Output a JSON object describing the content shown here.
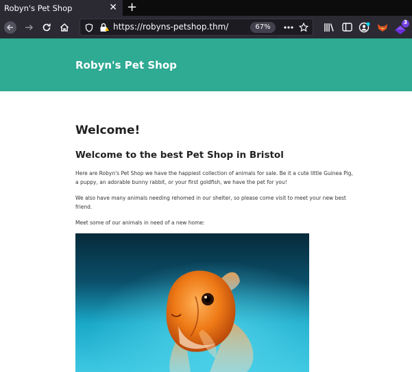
{
  "browser": {
    "tab": {
      "title": "Robyn's Pet Shop"
    },
    "url": "https://robyns-petshop.thm/",
    "zoom": "67%",
    "extension_badge": "3",
    "icons": {
      "back": "back-arrow-icon",
      "forward": "forward-arrow-icon",
      "reload": "reload-icon",
      "home": "home-icon",
      "tracking": "shield-icon",
      "security": "lock-warning-icon",
      "more": "more-dots-icon",
      "bookmark": "star-icon",
      "library": "library-icon",
      "sidebar": "sidebar-icon",
      "account": "account-icon",
      "ext1": "fox-extension-icon",
      "ext2": "extension-badge-icon"
    },
    "colors": {
      "chrome": "#2b2a33",
      "tabstrip": "#0c0c0d",
      "urlbar": "#1c1b22"
    }
  },
  "site": {
    "title": "Robyn's Pet Shop",
    "header_color": "#2faa93"
  },
  "content": {
    "heading": "Welcome!",
    "subheading": "Welcome to the best Pet Shop in Bristol",
    "paragraphs": [
      "Here are Robyn's Pet Shop we have the happiest collection of animals for sale. Be it a cute little Guinea Pig, a puppy, an adorable bunny rabbit, or your first goldfish, we have the pet for you!",
      "We also have many animals needing rehomed in our shelter, so please come visit to meet your new best friend.",
      "Meet some of our animals in need of a new home:"
    ]
  }
}
